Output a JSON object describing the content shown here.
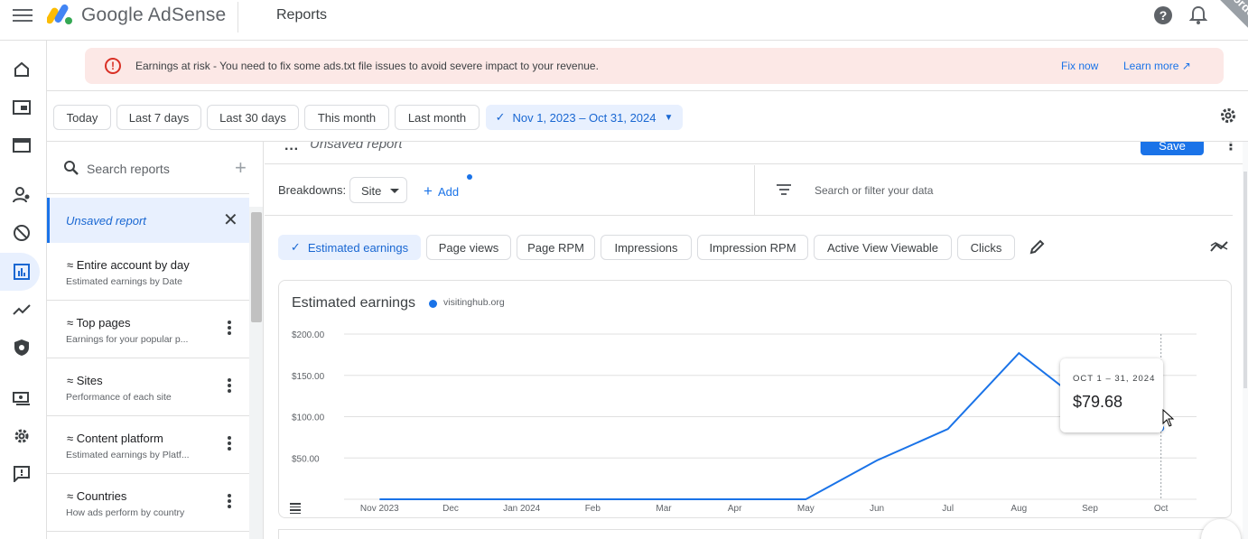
{
  "header": {
    "brand": "Google AdSense",
    "page_title": "Reports",
    "corner_badge": "corde"
  },
  "alert": {
    "text": "Earnings at risk - You need to fix some ads.txt file issues to avoid severe impact to your revenue.",
    "fix_label": "Fix now",
    "learn_label": "Learn more"
  },
  "date_range": {
    "chips": [
      "Today",
      "Last 7 days",
      "Last 30 days",
      "This month",
      "Last month"
    ],
    "selected": "Nov 1, 2023 – Oct 31, 2024"
  },
  "reports_panel": {
    "search_placeholder": "Search reports",
    "unsaved": "Unsaved report",
    "items": [
      {
        "title": "Entire account by day",
        "subtitle": "Estimated earnings by Date"
      },
      {
        "title": "Top pages",
        "subtitle": "Earnings for your popular p..."
      },
      {
        "title": "Sites",
        "subtitle": "Performance of each site"
      },
      {
        "title": "Content platform",
        "subtitle": "Estimated earnings by Platf..."
      },
      {
        "title": "Countries",
        "subtitle": "How ads perform by country"
      }
    ]
  },
  "main": {
    "report_name": "Unsaved report",
    "save_label": "Save",
    "breakdowns_label": "Breakdowns:",
    "breakdown_value": "Site",
    "add_label": "Add",
    "filter_placeholder": "Search or filter your data",
    "metrics": [
      "Estimated earnings",
      "Page views",
      "Page RPM",
      "Impressions",
      "Impression RPM",
      "Active View Viewable",
      "Clicks"
    ]
  },
  "chart_data": {
    "type": "line",
    "title": "Estimated earnings",
    "series": [
      {
        "name": "visitinghub.org",
        "color": "#1a73e8",
        "values": [
          0,
          0,
          0,
          0,
          0,
          0,
          0,
          0,
          47,
          85,
          177,
          110,
          86
        ]
      }
    ],
    "x": [
      "Nov 2023",
      "Dec",
      "Jan 2024",
      "Feb",
      "Mar",
      "Apr",
      "May",
      "Jun",
      "Jul",
      "Aug",
      "Sep",
      "Oct"
    ],
    "x_positions": [
      0.5,
      1.5,
      2.5,
      3.5,
      4.5,
      5.5,
      6.5,
      7.5,
      8.5,
      9.5,
      10.5,
      11.5
    ],
    "point_x": [
      0.5,
      1.5,
      2.5,
      3.5,
      4.5,
      5.5,
      6.5,
      6.5,
      7.5,
      8.5,
      9.5,
      10.5,
      11.5
    ],
    "point_values": [
      0,
      0,
      0,
      0,
      0,
      0,
      0,
      0,
      47,
      85,
      177,
      110,
      86
    ],
    "y_ticks": [
      "$50.00",
      "$100.00",
      "$150.00",
      "$200.00"
    ],
    "y_tick_values": [
      50,
      100,
      150,
      200
    ],
    "ylim": [
      0,
      200
    ],
    "grid": true,
    "tooltip": {
      "period": "OCT 1 – 31, 2024",
      "value": "$79.68"
    }
  },
  "colors": {
    "accent": "#1a73e8",
    "alert_bg": "#fce8e6",
    "alert_icon": "#d93025"
  }
}
